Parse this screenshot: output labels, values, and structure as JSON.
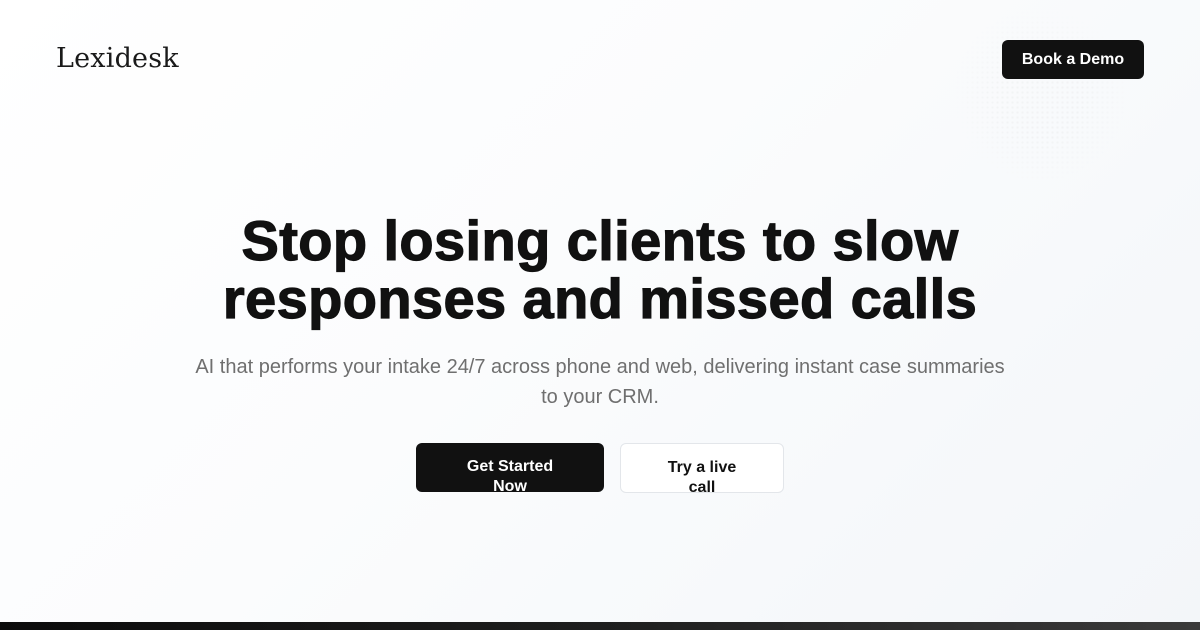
{
  "header": {
    "logo_text": "Lexidesk",
    "book_demo_label": "Book a Demo"
  },
  "hero": {
    "title": "Stop losing clients to slow responses and missed calls",
    "subtitle": "AI that performs your intake 24/7 across phone and web, delivering instant case summaries to your CRM.",
    "primary_cta_label": "Get Started Now",
    "secondary_cta_label": "Try a live call"
  },
  "colors": {
    "primary": "#111111",
    "subtitle_text": "#6f6f6f",
    "background": "#ffffff"
  }
}
